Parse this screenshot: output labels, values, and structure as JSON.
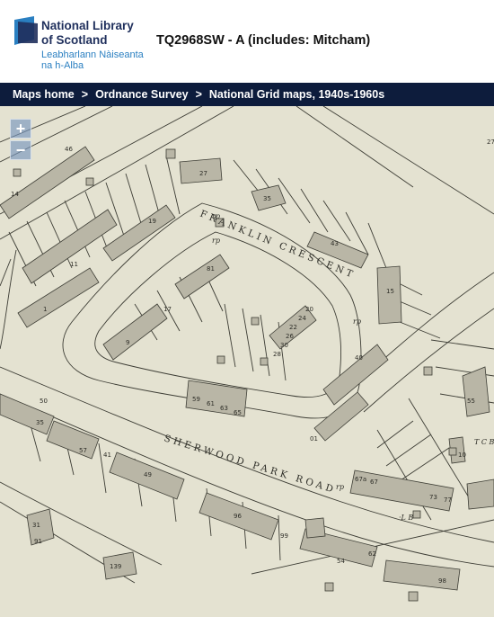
{
  "header": {
    "logo": {
      "line1": "National Library",
      "line2": "of Scotland",
      "gaelic1": "Leabharlann Nàiseanta",
      "gaelic2": "na h-Alba"
    },
    "title": "TQ2968SW - A (includes: Mitcham)"
  },
  "breadcrumb": {
    "items": [
      "Maps home",
      "Ordnance Survey",
      "National Grid maps, 1940s-1960s"
    ],
    "separator": ">"
  },
  "zoom": {
    "in_label": "+",
    "out_label": "−"
  },
  "map": {
    "street_labels": [
      "FRANKLIN CRESCENT",
      "SHERWOOD PARK ROAD"
    ],
    "annotations": [
      "·L B",
      "T C B",
      "rp"
    ],
    "house_numbers": [
      "27",
      "35",
      "43",
      "15",
      "1",
      "11",
      "19",
      "81",
      "9",
      "17",
      "24",
      "22",
      "30",
      "26",
      "20",
      "28",
      "59",
      "61",
      "63",
      "65",
      "35",
      "27",
      "57",
      "49",
      "41",
      "99",
      "31",
      "91",
      "139",
      "54",
      "62",
      "67a",
      "67",
      "73",
      "77",
      "96",
      "98",
      "40",
      "55",
      "50",
      "10",
      "01",
      "46",
      "14"
    ]
  },
  "colors": {
    "brand_navy": "#1f2f5c",
    "brand_blue": "#2a7fc1",
    "breadcrumb_bg": "#0d1c3c",
    "map_paper": "#e4e2d1",
    "map_ink": "#3d3d35",
    "building_fill": "#b9b6a6"
  }
}
